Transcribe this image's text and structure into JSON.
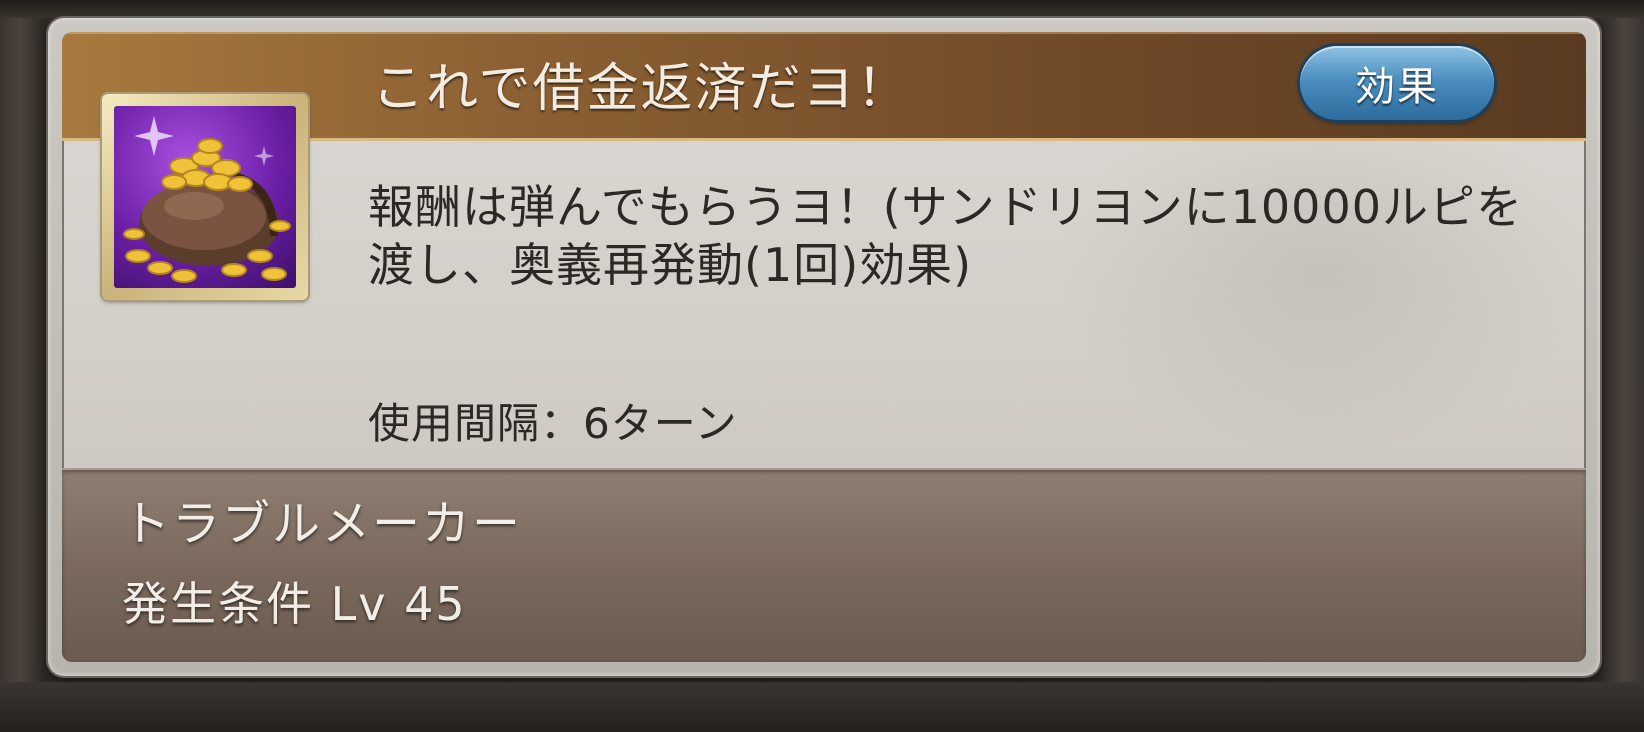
{
  "skill": {
    "name": "これで借金返済だヨ！",
    "effect_button_label": "効果",
    "icon": "coin-bag-icon",
    "description": "報酬は弾んでもらうヨ！(サンドリヨンに10000ルピを渡し、奥義再発動(1回)効果)",
    "cooldown": "使用間隔：6ターン"
  },
  "support": {
    "name": "トラブルメーカー",
    "unlock_condition": "発生条件 Lv 45"
  },
  "colors": {
    "title_bar": "#8c6033",
    "effect_button": "#4b8fc0",
    "footer": "#7a695c",
    "icon_background": "#6b1fa6",
    "coins": "#f0c23a"
  }
}
